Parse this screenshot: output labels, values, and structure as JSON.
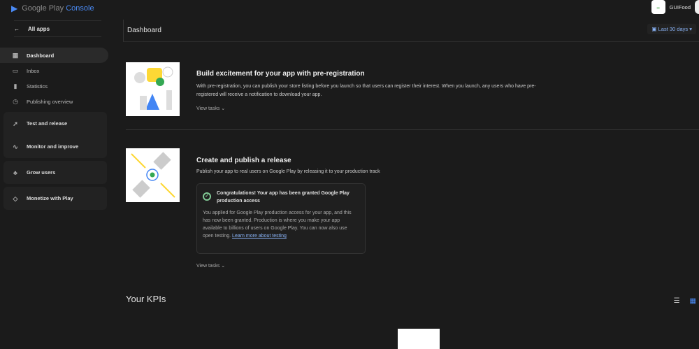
{
  "brand": {
    "name": "Google Play",
    "product": "Console"
  },
  "all_apps": "All apps",
  "nav": [
    {
      "label": "Dashboard",
      "icon": "dashboard-icon"
    },
    {
      "label": "Inbox",
      "icon": "inbox-icon"
    },
    {
      "label": "Statistics",
      "icon": "statistics-icon"
    },
    {
      "label": "Publishing overview",
      "icon": "publishing-icon"
    }
  ],
  "groups": [
    {
      "label": "Test and release",
      "icon": "rocket-icon"
    },
    {
      "label": "Monitor and improve",
      "icon": "pulse-icon"
    },
    {
      "label": "Grow users",
      "icon": "grow-icon"
    },
    {
      "label": "Monetize with Play",
      "icon": "tag-icon"
    }
  ],
  "header": {
    "title": "Dashboard",
    "range": "Last 30 days",
    "app_name": "GUIFood"
  },
  "cards": [
    {
      "title": "Build excitement for your app with pre-registration",
      "body": "With pre-registration, you can publish your store listing before you launch so that users can register their interest. When you launch, any users who have pre-registered will receive a notification to download your app.",
      "view": "View tasks"
    },
    {
      "title": "Create and publish a release",
      "body": "Publish your app to real users on Google Play by releasing it to your production track",
      "view": "View tasks"
    }
  ],
  "notice": {
    "title": "Congratulations! Your app has been granted Google Play production access",
    "body": "You applied for Google Play production access for your app, and this has now been granted. Production is where you make your app available to billions of users on Google Play. You can now also use open testing.",
    "link": "Learn more about testing"
  },
  "kpis": {
    "title": "Your KPIs"
  }
}
